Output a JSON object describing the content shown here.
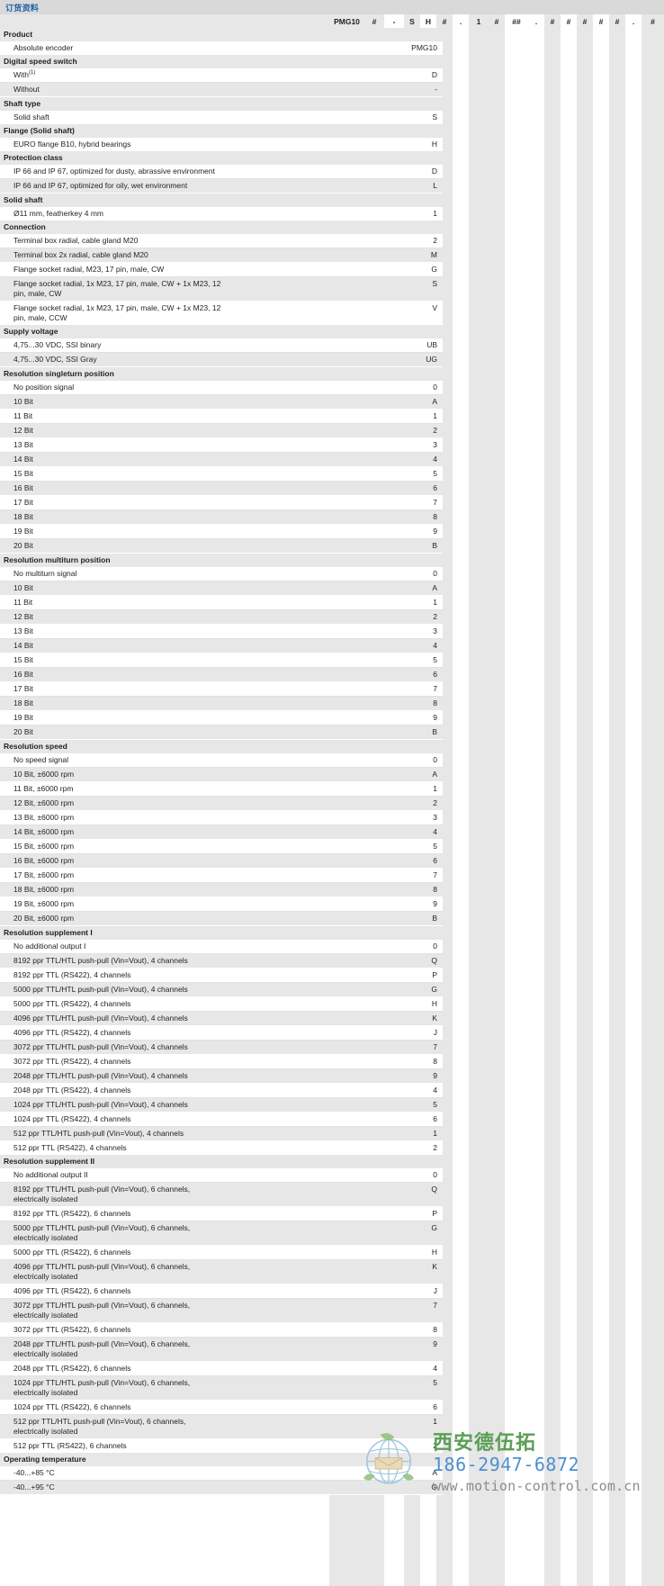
{
  "header": {
    "title": "订货资料",
    "accent_color": "#1f5fa9",
    "bar_color": "#d9d9d9"
  },
  "code_header": {
    "cells": [
      "PMG10",
      "#",
      "-",
      "S",
      "H",
      "#",
      ".",
      "1",
      "#",
      "##",
      ".",
      "#",
      "#",
      "#",
      "#",
      "#",
      ".",
      "#"
    ]
  },
  "watermark": {
    "company_cn": "西安德伍拓",
    "phone": "186-2947-6872",
    "website": "www.motion-control.com.cn",
    "company_color": "#5a9e55",
    "phone_color": "#4c8fd0",
    "website_color": "#8c8c8c"
  },
  "sections": [
    {
      "title": "Product",
      "col": 0,
      "options": [
        {
          "label": "Absolute encoder",
          "code": "PMG10"
        }
      ]
    },
    {
      "title": "Digital speed switch",
      "col": 1,
      "options": [
        {
          "label": "With",
          "sup": "(1)",
          "code": "D"
        },
        {
          "label": "Without",
          "code": "-"
        }
      ]
    },
    {
      "title": "Shaft type",
      "col": 2,
      "options": [
        {
          "label": "Solid shaft",
          "code": "S"
        }
      ]
    },
    {
      "title": "Flange (Solid shaft)",
      "col": 3,
      "options": [
        {
          "label": "EURO flange B10, hybrid bearings",
          "code": "H"
        }
      ]
    },
    {
      "title": "Protection class",
      "col": 4,
      "options": [
        {
          "label": "IP 66 and IP 67, optimized for dusty, abrassive environment",
          "code": "D"
        },
        {
          "label": "IP 66 and IP 67, optimized for oily, wet environment",
          "code": "L"
        }
      ]
    },
    {
      "title": "Solid shaft",
      "col": 5,
      "options": [
        {
          "label": "Ø11 mm, featherkey 4 mm",
          "code": "1"
        }
      ]
    },
    {
      "title": "Connection",
      "col": 6,
      "options": [
        {
          "label": "Terminal box radial, cable gland M20",
          "code": "2"
        },
        {
          "label": "Terminal box 2x radial, cable gland M20",
          "code": "M"
        },
        {
          "label": "Flange socket radial, M23, 17 pin, male, CW",
          "code": "G"
        },
        {
          "label": "Flange socket radial, 1x M23, 17 pin, male, CW + 1x M23, 12 pin, male, CW",
          "code": "S"
        },
        {
          "label": "Flange socket radial, 1x M23, 17 pin, male, CW + 1x M23, 12 pin, male, CCW",
          "code": "V"
        }
      ]
    },
    {
      "title": "Supply voltage",
      "col": 7,
      "options": [
        {
          "label": "4,75...30 VDC, SSI binary",
          "code": "UB"
        },
        {
          "label": "4,75...30 VDC, SSI Gray",
          "code": "UG"
        }
      ]
    },
    {
      "title": "Resolution singleturn position",
      "col": 8,
      "options": [
        {
          "label": "No position signal",
          "code": "0"
        },
        {
          "label": "10 Bit",
          "code": "A"
        },
        {
          "label": "11 Bit",
          "code": "1"
        },
        {
          "label": "12 Bit",
          "code": "2"
        },
        {
          "label": "13 Bit",
          "code": "3"
        },
        {
          "label": "14 Bit",
          "code": "4"
        },
        {
          "label": "15 Bit",
          "code": "5"
        },
        {
          "label": "16 Bit",
          "code": "6"
        },
        {
          "label": "17 Bit",
          "code": "7"
        },
        {
          "label": "18 Bit",
          "code": "8"
        },
        {
          "label": "19 Bit",
          "code": "9"
        },
        {
          "label": "20 Bit",
          "code": "B"
        }
      ]
    },
    {
      "title": "Resolution multiturn position",
      "col": 9,
      "options": [
        {
          "label": "No multiturn signal",
          "code": "0"
        },
        {
          "label": "10 Bit",
          "code": "A"
        },
        {
          "label": "11 Bit",
          "code": "1"
        },
        {
          "label": "12 Bit",
          "code": "2"
        },
        {
          "label": "13 Bit",
          "code": "3"
        },
        {
          "label": "14 Bit",
          "code": "4"
        },
        {
          "label": "15 Bit",
          "code": "5"
        },
        {
          "label": "16 Bit",
          "code": "6"
        },
        {
          "label": "17 Bit",
          "code": "7"
        },
        {
          "label": "18 Bit",
          "code": "8"
        },
        {
          "label": "19 Bit",
          "code": "9"
        },
        {
          "label": "20 Bit",
          "code": "B"
        }
      ]
    },
    {
      "title": "Resolution speed",
      "col": 10,
      "options": [
        {
          "label": "No speed signal",
          "code": "0"
        },
        {
          "label": "10 Bit, ±6000 rpm",
          "code": "A"
        },
        {
          "label": "11 Bit, ±6000 rpm",
          "code": "1"
        },
        {
          "label": "12 Bit, ±6000 rpm",
          "code": "2"
        },
        {
          "label": "13 Bit, ±6000 rpm",
          "code": "3"
        },
        {
          "label": "14 Bit, ±6000 rpm",
          "code": "4"
        },
        {
          "label": "15 Bit, ±6000 rpm",
          "code": "5"
        },
        {
          "label": "16 Bit, ±6000 rpm",
          "code": "6"
        },
        {
          "label": "17 Bit, ±6000 rpm",
          "code": "7"
        },
        {
          "label": "18 Bit, ±6000 rpm",
          "code": "8"
        },
        {
          "label": "19 Bit, ±6000 rpm",
          "code": "9"
        },
        {
          "label": "20 Bit, ±6000 rpm",
          "code": "B"
        }
      ]
    },
    {
      "title": "Resolution supplement I",
      "col": 11,
      "options": [
        {
          "label": "No additional output I",
          "code": "0"
        },
        {
          "label": "8192 ppr TTL/HTL push-pull (Vin=Vout), 4 channels",
          "code": "Q"
        },
        {
          "label": "8192 ppr TTL (RS422), 4 channels",
          "code": "P"
        },
        {
          "label": "5000 ppr TTL/HTL push-pull (Vin=Vout), 4 channels",
          "code": "G"
        },
        {
          "label": "5000 ppr TTL (RS422), 4 channels",
          "code": "H"
        },
        {
          "label": "4096 ppr TTL/HTL push-pull (Vin=Vout), 4 channels",
          "code": "K"
        },
        {
          "label": "4096 ppr TTL (RS422), 4 channels",
          "code": "J"
        },
        {
          "label": "3072 ppr TTL/HTL push-pull (Vin=Vout), 4 channels",
          "code": "7"
        },
        {
          "label": "3072 ppr TTL (RS422), 4 channels",
          "code": "8"
        },
        {
          "label": "2048 ppr TTL/HTL push-pull (Vin=Vout), 4 channels",
          "code": "9"
        },
        {
          "label": "2048 ppr TTL (RS422), 4 channels",
          "code": "4"
        },
        {
          "label": "1024 ppr TTL/HTL push-pull (Vin=Vout), 4 channels",
          "code": "5"
        },
        {
          "label": "1024 ppr TTL (RS422), 4 channels",
          "code": "6"
        },
        {
          "label": "512 ppr TTL/HTL push-pull (Vin=Vout), 4 channels",
          "code": "1"
        },
        {
          "label": "512 ppr TTL (RS422), 4 channels",
          "code": "2"
        }
      ]
    },
    {
      "title": "Resolution supplement II",
      "col": 12,
      "options": [
        {
          "label": "No additional output II",
          "code": "0"
        },
        {
          "label": "8192 ppr TTL/HTL push-pull (Vin=Vout), 6 channels, electrically isolated",
          "code": "Q"
        },
        {
          "label": "8192 ppr TTL (RS422), 6 channels",
          "code": "P"
        },
        {
          "label": "5000 ppr TTL/HTL push-pull (Vin=Vout), 6 channels, electrically isolated",
          "code": "G"
        },
        {
          "label": "5000 ppr TTL (RS422), 6 channels",
          "code": "H"
        },
        {
          "label": "4096 ppr TTL/HTL push-pull (Vin=Vout), 6 channels, electrically isolated",
          "code": "K"
        },
        {
          "label": "4096 ppr TTL (RS422), 6 channels",
          "code": "J"
        },
        {
          "label": "3072 ppr TTL/HTL push-pull (Vin=Vout), 6 channels, electrically isolated",
          "code": "7"
        },
        {
          "label": "3072 ppr TTL (RS422), 6 channels",
          "code": "8"
        },
        {
          "label": "2048 ppr TTL/HTL push-pull (Vin=Vout), 6 channels, electrically isolated",
          "code": "9"
        },
        {
          "label": "2048 ppr TTL (RS422), 6 channels",
          "code": "4"
        },
        {
          "label": "1024 ppr TTL/HTL push-pull (Vin=Vout), 6 channels, electrically isolated",
          "code": "5"
        },
        {
          "label": "1024 ppr TTL (RS422), 6 channels",
          "code": "6"
        },
        {
          "label": "512 ppr TTL/HTL push-pull (Vin=Vout), 6 channels, electrically isolated",
          "code": "1"
        },
        {
          "label": "512 ppr TTL (RS422), 6 channels",
          "code": "2"
        }
      ]
    },
    {
      "title": "Operating temperature",
      "col": 13,
      "options": [
        {
          "label": "-40...+85 °C",
          "code": "A"
        },
        {
          "label": "-40...+95 °C",
          "code": "G"
        }
      ]
    }
  ]
}
